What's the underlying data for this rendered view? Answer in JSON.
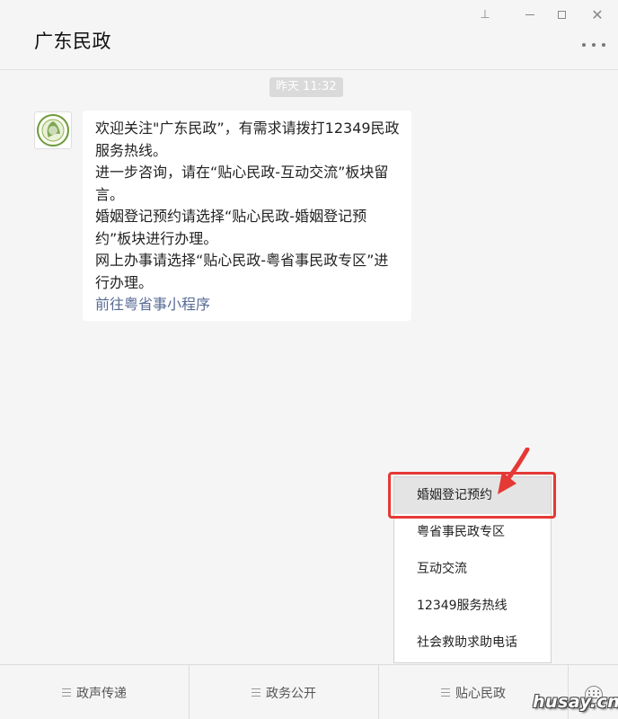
{
  "window": {
    "title": "广东民政",
    "pin_glyph": "⊥",
    "close_glyph": "✕"
  },
  "chat": {
    "timestamp": "昨天 11:32",
    "avatar_icon": "minzheng-logo-icon",
    "message": {
      "line1": "欢迎关注\"广东民政”，有需求请拨打12349民政服务热线。",
      "line2": "进一步咨询，请在“贴心民政-互动交流”板块留言。",
      "line3": "婚姻登记预约请选择“贴心民政-婚姻登记预约”板块进行办理。",
      "line4": "网上办事请选择“贴心民政-粤省事民政专区”进行办理。",
      "link": "前往粤省事小程序"
    }
  },
  "popup_menu": {
    "items": [
      {
        "label": "婚姻登记预约"
      },
      {
        "label": "粤省事民政专区"
      },
      {
        "label": "互动交流"
      },
      {
        "label": "12349服务热线"
      },
      {
        "label": "社会救助求助电话"
      }
    ]
  },
  "bottom_menu": {
    "items": [
      {
        "label": "政声传递"
      },
      {
        "label": "政务公开"
      },
      {
        "label": "贴心民政"
      }
    ],
    "keyboard_icon": "keyboard-icon"
  },
  "watermark": "husay.cn",
  "colors": {
    "link": "#576b95",
    "highlight": "#e53935",
    "background": "#f5f5f5"
  }
}
